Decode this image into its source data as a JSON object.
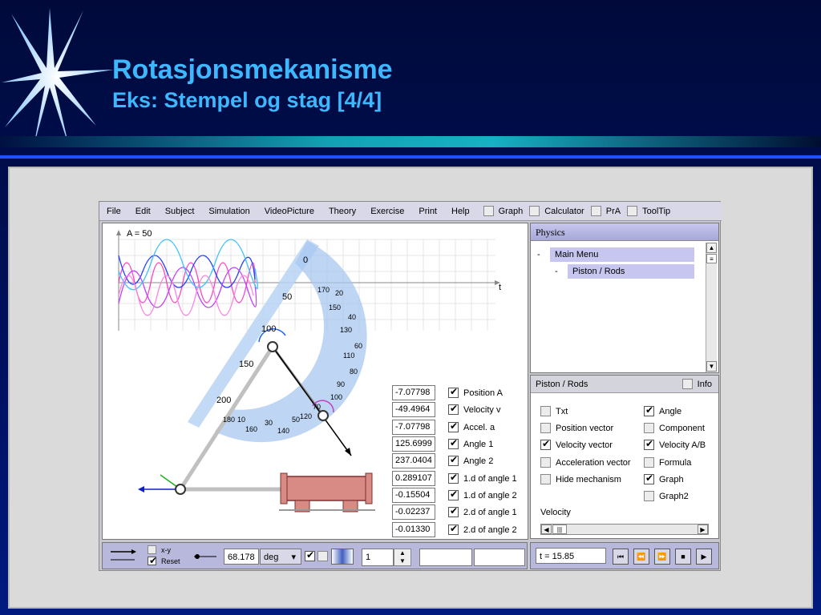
{
  "slide": {
    "title": "Rotasjonsmekanisme",
    "subtitle": "Eks:  Stempel og stag   [4/4]",
    "accent_color": "#3db8ff",
    "star_icon": "starburst-icon"
  },
  "menubar": {
    "items": [
      "File",
      "Edit",
      "Subject",
      "Simulation",
      "VideoPicture",
      "Theory",
      "Exercise",
      "Print",
      "Help"
    ],
    "toggles": [
      {
        "label": "Graph",
        "checked": false
      },
      {
        "label": "Calculator",
        "checked": false
      },
      {
        "label": "PrA",
        "checked": false
      },
      {
        "label": "ToolTip",
        "checked": false
      }
    ]
  },
  "canvas": {
    "amplitude_label": "A = 50",
    "time_axis_label": "t",
    "protractor_outer_ticks": [
      "0",
      "50",
      "100",
      "150",
      "200"
    ],
    "protractor_inner_ticks": [
      "170",
      "20",
      "150",
      "40",
      "130",
      "60",
      "110",
      "80",
      "90",
      "100",
      "70",
      "120",
      "50",
      "140",
      "30",
      "160",
      "10",
      "180"
    ]
  },
  "readouts": [
    {
      "value": "-7.07798",
      "label": "Position A",
      "checked": true
    },
    {
      "value": "-49.4964",
      "label": "Velocity v",
      "checked": true
    },
    {
      "value": "-7.07798",
      "label": "Accel. a",
      "checked": true
    },
    {
      "value": "125.6999",
      "label": "Angle 1",
      "checked": true
    },
    {
      "value": "237.0404",
      "label": "Angle 2",
      "checked": true
    },
    {
      "value": "0.289107",
      "label": "1.d of angle 1",
      "checked": true
    },
    {
      "value": "-0.15504",
      "label": "1.d of angle 2",
      "checked": true
    },
    {
      "value": "-0.02237",
      "label": "2.d of angle 1",
      "checked": true
    },
    {
      "value": "-0.01330",
      "label": "2.d of angle 2",
      "checked": true
    }
  ],
  "sidebar": {
    "header": "Physics",
    "tree": [
      {
        "prefix": "-",
        "label": "Main Menu"
      },
      {
        "prefix": "-",
        "label": "Piston / Rods"
      }
    ]
  },
  "options_panel": {
    "title": "Piston / Rods",
    "info_label": "Info",
    "left_options": [
      {
        "label": "Txt",
        "checked": false
      },
      {
        "label": "Position vector",
        "checked": false
      },
      {
        "label": "Velocity vector",
        "checked": true
      },
      {
        "label": "Acceleration vector",
        "checked": false
      },
      {
        "label": "Hide mechanism",
        "checked": false
      }
    ],
    "right_options": [
      {
        "label": "Angle",
        "checked": true
      },
      {
        "label": "Component",
        "checked": false
      },
      {
        "label": "Velocity A/B",
        "checked": true
      },
      {
        "label": "Formula",
        "checked": false
      },
      {
        "label": "Graph",
        "checked": true
      },
      {
        "label": "Graph2",
        "checked": false
      }
    ],
    "footer_label": "Velocity"
  },
  "bottom_left": {
    "xy_label": "x-y",
    "reset_label": "Reset",
    "angle_value": "68.178",
    "unit_label": "deg",
    "step_value": "1"
  },
  "bottom_right": {
    "time_value": "t = 15.85",
    "controls": [
      "skip-back-icon",
      "rewind-icon",
      "fast-forward-icon",
      "stop-icon",
      "play-icon"
    ]
  }
}
